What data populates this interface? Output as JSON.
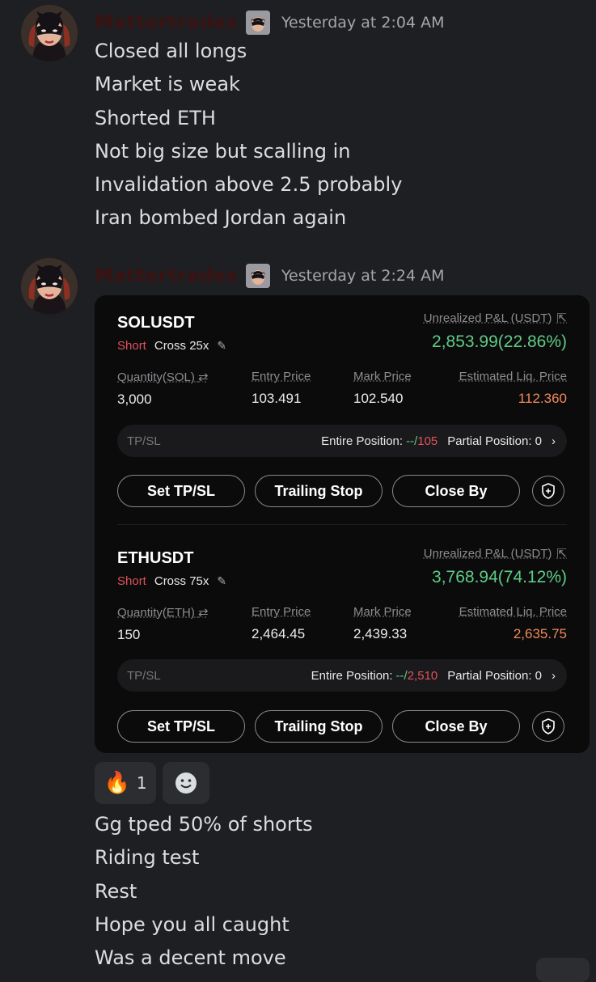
{
  "messages": [
    {
      "username": "Mattertrades",
      "timestamp": "Yesterday at 2:04 AM",
      "lines": [
        "Closed all longs",
        "Market is weak",
        "Shorted ETH",
        "Not big size but scalling in",
        "Invalidation above 2.5 probably",
        "Iran bombed Jordan again"
      ]
    },
    {
      "username": "Mattertrades",
      "timestamp": "Yesterday at 2:24 AM",
      "positions": [
        {
          "symbol": "SOLUSDT",
          "side": "Short",
          "mode": "Cross 25x",
          "upl_label": "Unrealized P&L (USDT)",
          "upl_value": "2,853.99(22.86%)",
          "qty_label": "Quantity(SOL)",
          "qty": "3,000",
          "entry_label": "Entry Price",
          "entry": "103.491",
          "mark_label": "Mark Price",
          "mark": "102.540",
          "liq_label": "Estimated Liq. Price",
          "liq": "112.360",
          "tpsl_label": "TP/SL",
          "entire_label": "Entire Position:",
          "entire_tp": "--",
          "entire_sep": "/",
          "entire_sl": "105",
          "partial_label": "Partial Position: 0"
        },
        {
          "symbol": "ETHUSDT",
          "side": "Short",
          "mode": "Cross 75x",
          "upl_label": "Unrealized P&L (USDT)",
          "upl_value": "3,768.94(74.12%)",
          "qty_label": "Quantity(ETH)",
          "qty": "150",
          "entry_label": "Entry Price",
          "entry": "2,464.45",
          "mark_label": "Mark Price",
          "mark": "2,439.33",
          "liq_label": "Estimated Liq. Price",
          "liq": "2,635.75",
          "tpsl_label": "TP/SL",
          "entire_label": "Entire Position:",
          "entire_tp": "--",
          "entire_sep": "/",
          "entire_sl": "2,510",
          "partial_label": "Partial Position: 0"
        }
      ],
      "buttons": {
        "set_tpsl": "Set TP/SL",
        "trailing": "Trailing Stop",
        "close_by": "Close By"
      },
      "reactions": [
        {
          "icon": "fire-emoji",
          "emoji": "🔥",
          "count": "1"
        }
      ],
      "lines": [
        "Gg tped 50% of shorts",
        "Riding test",
        "Rest",
        "Hope you all caught",
        "Was a decent move"
      ]
    }
  ],
  "colors": {
    "background": "#1e1f22",
    "profit": "#5fcb86",
    "short": "#e2515b",
    "liq": "#f08a5c"
  }
}
